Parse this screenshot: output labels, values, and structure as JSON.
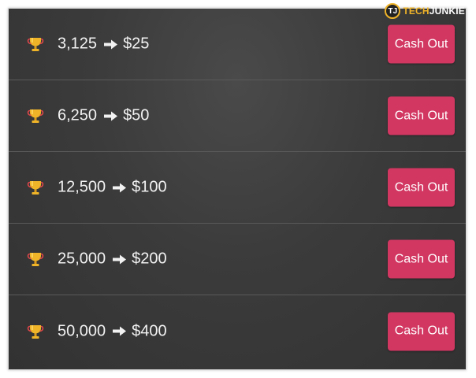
{
  "watermark": {
    "logo_letters": "TJ",
    "brand_part1": "TECH",
    "brand_part2": "JUNKIE"
  },
  "rewards": [
    {
      "points": "3,125",
      "amount": "$25",
      "button_label": "Cash Out"
    },
    {
      "points": "6,250",
      "amount": "$50",
      "button_label": "Cash Out"
    },
    {
      "points": "12,500",
      "amount": "$100",
      "button_label": "Cash Out"
    },
    {
      "points": "25,000",
      "amount": "$200",
      "button_label": "Cash Out"
    },
    {
      "points": "50,000",
      "amount": "$400",
      "button_label": "Cash Out"
    }
  ],
  "icons": {
    "row_icon": "trophy-icon",
    "separator_icon": "right-arrow-icon"
  },
  "colors": {
    "button": "#d23762",
    "background": "#3b3b3b",
    "trophy": "#f0b429"
  }
}
